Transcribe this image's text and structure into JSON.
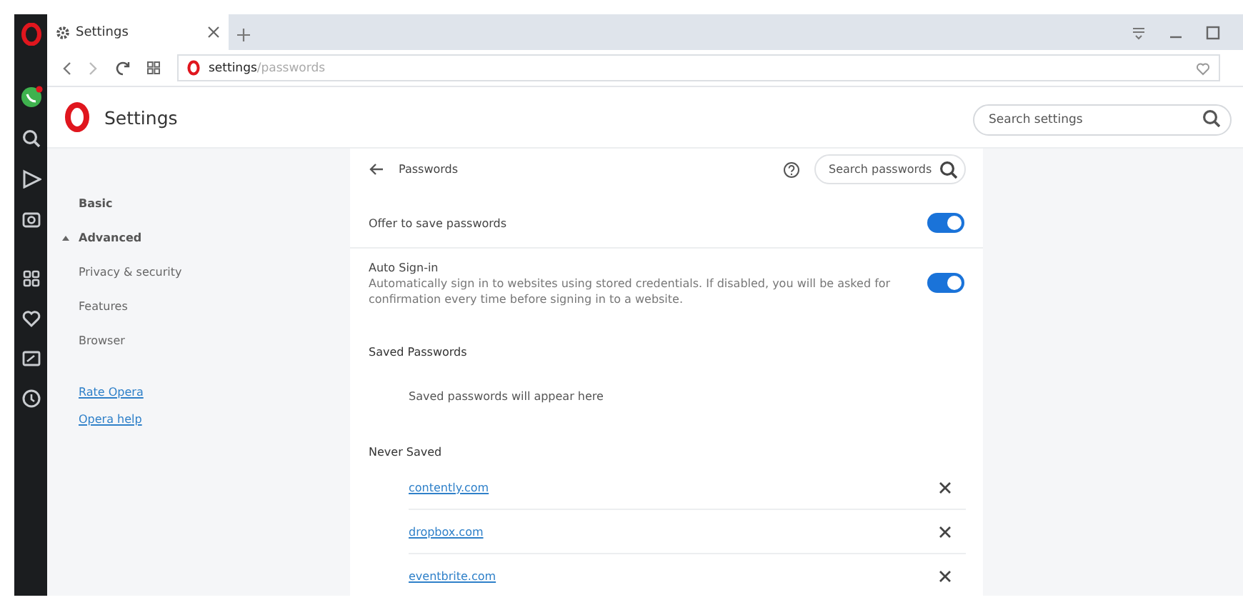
{
  "tabs": [
    {
      "label": "Settings",
      "selected": true
    }
  ],
  "address_bar": {
    "host": "settings",
    "path": "/passwords"
  },
  "header": {
    "title": "Settings",
    "search": {
      "placeholder": "Search settings"
    }
  },
  "nav": {
    "items": [
      {
        "label": "Basic",
        "kind": "section"
      },
      {
        "label": "Advanced",
        "kind": "expandable",
        "expanded": true,
        "children": [
          {
            "label": "Privacy & security"
          },
          {
            "label": "Features"
          },
          {
            "label": "Browser"
          }
        ]
      }
    ],
    "links": [
      "Rate Opera",
      "Opera help"
    ]
  },
  "passwords": {
    "title": "Passwords",
    "search": {
      "placeholder": "Search passwords"
    },
    "settings": [
      {
        "label": "Offer to save passwords",
        "on": true
      },
      {
        "label": "Auto Sign-in",
        "description": "Automatically sign in to websites using stored credentials. If disabled, you will be asked for confirmation every time before signing in to a website.",
        "on": true
      }
    ],
    "saved": {
      "heading": "Saved Passwords",
      "empty_text": "Saved passwords will appear here"
    },
    "never_saved": {
      "heading": "Never Saved",
      "sites": [
        "contently.com",
        "dropbox.com",
        "eventbrite.com"
      ]
    }
  }
}
